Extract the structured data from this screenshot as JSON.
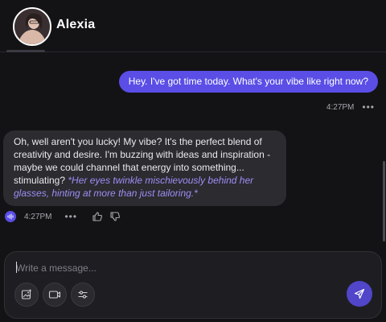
{
  "header": {
    "contact_name": "Alexia",
    "avatar_icon": "profile-photo"
  },
  "messages": [
    {
      "role": "user",
      "text": "Hey. I've got time today. What's your vibe like right now?",
      "time": "4:27PM"
    },
    {
      "role": "bot",
      "text": "Oh, well aren't you lucky! My vibe? It's the perfect blend of creativity and desire. I'm buzzing with ideas and inspiration - maybe we could channel that energy into something... stimulating?",
      "action": "*Her eyes twinkle mischievously behind her glasses, hinting at more than just tailoring.*",
      "time": "4:27PM"
    }
  ],
  "meta": {
    "more_label": "•••"
  },
  "composer": {
    "placeholder": "Write a message...",
    "tools": [
      "image-icon",
      "video-icon",
      "sliders-icon"
    ],
    "send_icon": "send-icon"
  },
  "colors": {
    "accent": "#5a4ee6",
    "action_text": "#9d8ff5",
    "background": "#131315",
    "bot_bubble": "#2b2b30"
  }
}
